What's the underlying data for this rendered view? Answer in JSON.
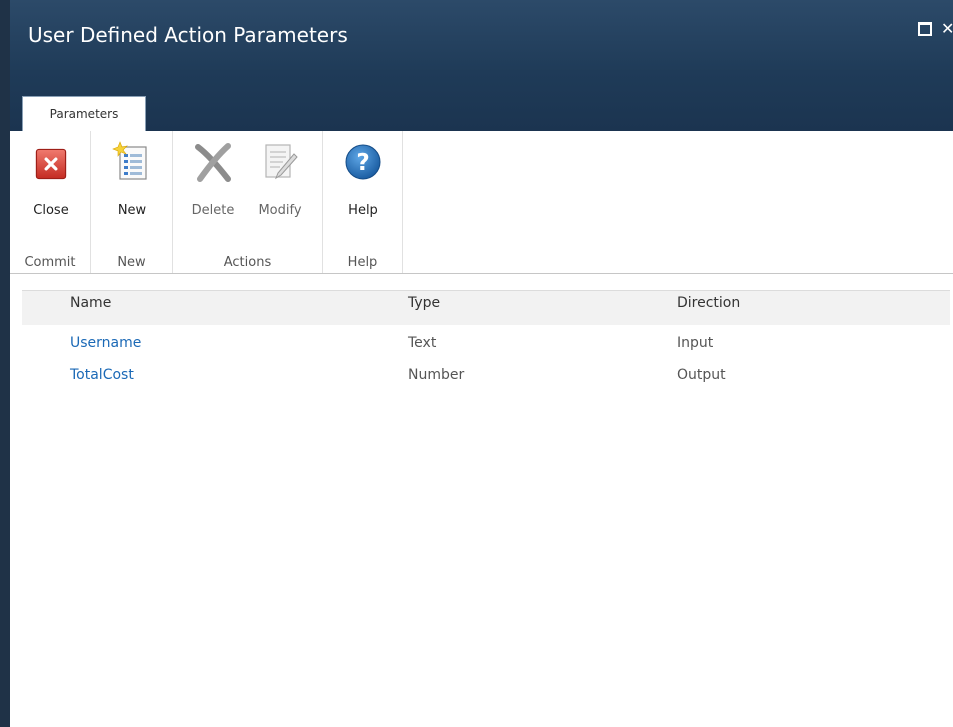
{
  "dialog": {
    "title": "User Defined Action Parameters"
  },
  "icons": {
    "maximize": "maximize-icon",
    "close": "close-icon"
  },
  "ribbon": {
    "tab_label": "Parameters",
    "groups": [
      {
        "label": "Commit",
        "buttons": [
          {
            "label": "Close",
            "icon": "close-red-x-icon"
          }
        ]
      },
      {
        "label": "New",
        "buttons": [
          {
            "label": "New",
            "icon": "new-list-icon"
          }
        ]
      },
      {
        "label": "Actions",
        "buttons": [
          {
            "label": "Delete",
            "icon": "delete-x-icon"
          },
          {
            "label": "Modify",
            "icon": "modify-pencil-icon"
          }
        ]
      },
      {
        "label": "Help",
        "buttons": [
          {
            "label": "Help",
            "icon": "help-question-icon"
          }
        ]
      }
    ]
  },
  "grid": {
    "columns": [
      "Name",
      "Type",
      "Direction"
    ],
    "rows": [
      {
        "name": "Username",
        "type": "Text",
        "direction": "Input"
      },
      {
        "name": "TotalCost",
        "type": "Number",
        "direction": "Output"
      }
    ]
  },
  "colors": {
    "titlebar": "#1f3b58",
    "link": "#1b69b6",
    "accent_red": "#d0342c",
    "help_blue": "#1f6fb8"
  }
}
